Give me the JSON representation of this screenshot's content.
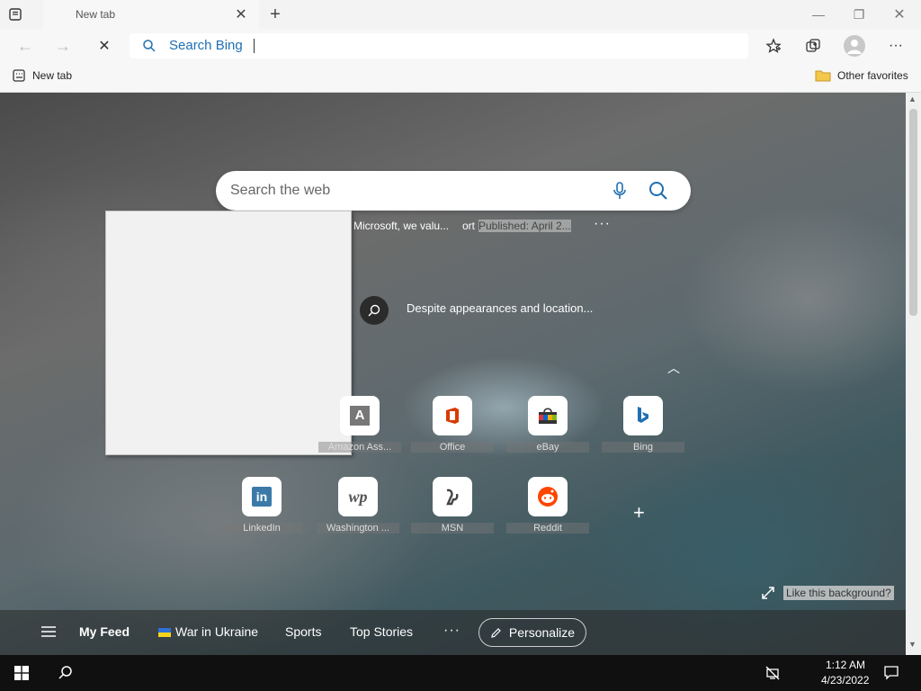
{
  "browser": {
    "tab": {
      "title": "New tab"
    },
    "address_bar": {
      "placeholder": "Search Bing",
      "value": ""
    },
    "favorites_bar": {
      "new_tab_label": "New tab",
      "other_favorites_label": "Other favorites"
    },
    "icons": {
      "tab_actions": "tab-actions-icon",
      "close_tab": "close-icon",
      "new_tab": "plus-icon",
      "minimize": "minimize-icon",
      "restore": "restore-icon",
      "close_window": "close-icon",
      "back": "back-arrow-icon",
      "forward": "forward-arrow-icon",
      "stop": "stop-icon",
      "favorites": "star-icon",
      "collections": "collections-icon",
      "profile": "avatar",
      "settings_more": "more-icon",
      "folder": "folder-icon"
    }
  },
  "new_tab_page": {
    "search": {
      "placeholder": "Search the web",
      "mic_icon": "mic-icon",
      "search_icon": "search-icon"
    },
    "news_ticker": {
      "headline": "Microsoft, we valu...",
      "publisher": "ort",
      "published": "Published: April 2...",
      "more": "···"
    },
    "image_of_day": {
      "caption": "Despite appearances and location..."
    },
    "quick_links": [
      {
        "label": "Amazon Ass...",
        "icon": "amazon-assistant-icon"
      },
      {
        "label": "Office",
        "icon": "office-icon"
      },
      {
        "label": "eBay",
        "icon": "ebay-icon"
      },
      {
        "label": "Bing",
        "icon": "bing-icon"
      },
      {
        "label": "LinkedIn",
        "icon": "linkedin-icon"
      },
      {
        "label": "Washington ...",
        "icon": "washington-post-icon"
      },
      {
        "label": "MSN",
        "icon": "msn-icon"
      },
      {
        "label": "Reddit",
        "icon": "reddit-icon"
      }
    ],
    "add_site": "+",
    "background_prompt": "Like this background?",
    "feed_nav": {
      "my_feed": "My Feed",
      "war_in_ukraine": "War in Ukraine",
      "sports": "Sports",
      "top_stories": "Top Stories",
      "more": "···",
      "personalize": "Personalize"
    }
  },
  "taskbar": {
    "time": "1:12 AM",
    "date": "4/23/2022"
  },
  "colors": {
    "accent": "#1f6fb2",
    "page_bg": "#5d6a6f",
    "taskbar": "#101010"
  }
}
